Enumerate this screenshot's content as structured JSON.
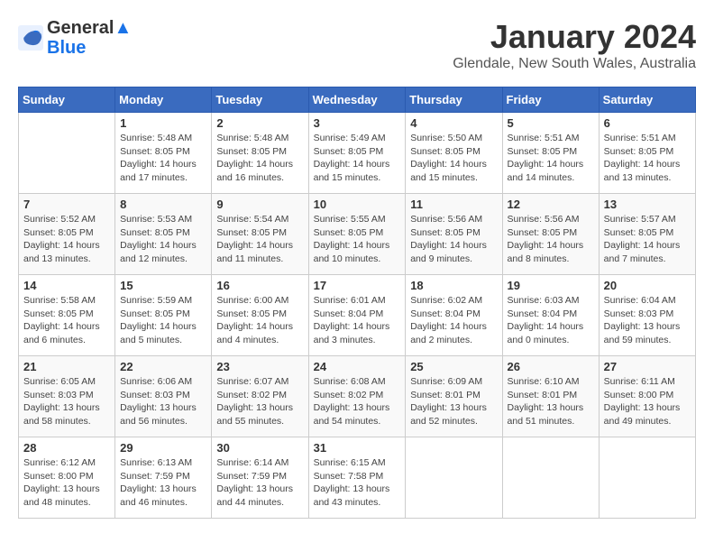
{
  "header": {
    "logo_line1": "General",
    "logo_line2": "Blue",
    "month": "January 2024",
    "location": "Glendale, New South Wales, Australia"
  },
  "weekdays": [
    "Sunday",
    "Monday",
    "Tuesday",
    "Wednesday",
    "Thursday",
    "Friday",
    "Saturday"
  ],
  "weeks": [
    [
      {
        "day": "",
        "sunrise": "",
        "sunset": "",
        "daylight": ""
      },
      {
        "day": "1",
        "sunrise": "5:48 AM",
        "sunset": "8:05 PM",
        "daylight": "14 hours and 17 minutes."
      },
      {
        "day": "2",
        "sunrise": "5:48 AM",
        "sunset": "8:05 PM",
        "daylight": "14 hours and 16 minutes."
      },
      {
        "day": "3",
        "sunrise": "5:49 AM",
        "sunset": "8:05 PM",
        "daylight": "14 hours and 15 minutes."
      },
      {
        "day": "4",
        "sunrise": "5:50 AM",
        "sunset": "8:05 PM",
        "daylight": "14 hours and 15 minutes."
      },
      {
        "day": "5",
        "sunrise": "5:51 AM",
        "sunset": "8:05 PM",
        "daylight": "14 hours and 14 minutes."
      },
      {
        "day": "6",
        "sunrise": "5:51 AM",
        "sunset": "8:05 PM",
        "daylight": "14 hours and 13 minutes."
      }
    ],
    [
      {
        "day": "7",
        "sunrise": "5:52 AM",
        "sunset": "8:05 PM",
        "daylight": "14 hours and 13 minutes."
      },
      {
        "day": "8",
        "sunrise": "5:53 AM",
        "sunset": "8:05 PM",
        "daylight": "14 hours and 12 minutes."
      },
      {
        "day": "9",
        "sunrise": "5:54 AM",
        "sunset": "8:05 PM",
        "daylight": "14 hours and 11 minutes."
      },
      {
        "day": "10",
        "sunrise": "5:55 AM",
        "sunset": "8:05 PM",
        "daylight": "14 hours and 10 minutes."
      },
      {
        "day": "11",
        "sunrise": "5:56 AM",
        "sunset": "8:05 PM",
        "daylight": "14 hours and 9 minutes."
      },
      {
        "day": "12",
        "sunrise": "5:56 AM",
        "sunset": "8:05 PM",
        "daylight": "14 hours and 8 minutes."
      },
      {
        "day": "13",
        "sunrise": "5:57 AM",
        "sunset": "8:05 PM",
        "daylight": "14 hours and 7 minutes."
      }
    ],
    [
      {
        "day": "14",
        "sunrise": "5:58 AM",
        "sunset": "8:05 PM",
        "daylight": "14 hours and 6 minutes."
      },
      {
        "day": "15",
        "sunrise": "5:59 AM",
        "sunset": "8:05 PM",
        "daylight": "14 hours and 5 minutes."
      },
      {
        "day": "16",
        "sunrise": "6:00 AM",
        "sunset": "8:05 PM",
        "daylight": "14 hours and 4 minutes."
      },
      {
        "day": "17",
        "sunrise": "6:01 AM",
        "sunset": "8:04 PM",
        "daylight": "14 hours and 3 minutes."
      },
      {
        "day": "18",
        "sunrise": "6:02 AM",
        "sunset": "8:04 PM",
        "daylight": "14 hours and 2 minutes."
      },
      {
        "day": "19",
        "sunrise": "6:03 AM",
        "sunset": "8:04 PM",
        "daylight": "14 hours and 0 minutes."
      },
      {
        "day": "20",
        "sunrise": "6:04 AM",
        "sunset": "8:03 PM",
        "daylight": "13 hours and 59 minutes."
      }
    ],
    [
      {
        "day": "21",
        "sunrise": "6:05 AM",
        "sunset": "8:03 PM",
        "daylight": "13 hours and 58 minutes."
      },
      {
        "day": "22",
        "sunrise": "6:06 AM",
        "sunset": "8:03 PM",
        "daylight": "13 hours and 56 minutes."
      },
      {
        "day": "23",
        "sunrise": "6:07 AM",
        "sunset": "8:02 PM",
        "daylight": "13 hours and 55 minutes."
      },
      {
        "day": "24",
        "sunrise": "6:08 AM",
        "sunset": "8:02 PM",
        "daylight": "13 hours and 54 minutes."
      },
      {
        "day": "25",
        "sunrise": "6:09 AM",
        "sunset": "8:01 PM",
        "daylight": "13 hours and 52 minutes."
      },
      {
        "day": "26",
        "sunrise": "6:10 AM",
        "sunset": "8:01 PM",
        "daylight": "13 hours and 51 minutes."
      },
      {
        "day": "27",
        "sunrise": "6:11 AM",
        "sunset": "8:00 PM",
        "daylight": "13 hours and 49 minutes."
      }
    ],
    [
      {
        "day": "28",
        "sunrise": "6:12 AM",
        "sunset": "8:00 PM",
        "daylight": "13 hours and 48 minutes."
      },
      {
        "day": "29",
        "sunrise": "6:13 AM",
        "sunset": "7:59 PM",
        "daylight": "13 hours and 46 minutes."
      },
      {
        "day": "30",
        "sunrise": "6:14 AM",
        "sunset": "7:59 PM",
        "daylight": "13 hours and 44 minutes."
      },
      {
        "day": "31",
        "sunrise": "6:15 AM",
        "sunset": "7:58 PM",
        "daylight": "13 hours and 43 minutes."
      },
      {
        "day": "",
        "sunrise": "",
        "sunset": "",
        "daylight": ""
      },
      {
        "day": "",
        "sunrise": "",
        "sunset": "",
        "daylight": ""
      },
      {
        "day": "",
        "sunrise": "",
        "sunset": "",
        "daylight": ""
      }
    ]
  ]
}
